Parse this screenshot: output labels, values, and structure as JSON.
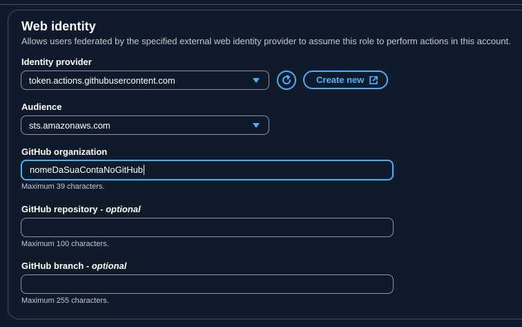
{
  "section": {
    "title": "Web identity",
    "description": "Allows users federated by the specified external web identity provider to assume this role to perform actions in this account."
  },
  "identity_provider": {
    "label": "Identity provider",
    "value": "token.actions.githubusercontent.com",
    "create_new_label": "Create new",
    "refresh_icon": "refresh-icon",
    "external_icon": "external-link-icon"
  },
  "audience": {
    "label": "Audience",
    "value": "sts.amazonaws.com"
  },
  "github_organization": {
    "label": "GitHub organization",
    "value": "nomeDaSuaContaNoGitHub",
    "hint": "Maximum 39 characters."
  },
  "github_repository": {
    "label": "GitHub repository",
    "label_suffix": "- optional",
    "value": "",
    "hint": "Maximum 100 characters."
  },
  "github_branch": {
    "label": "GitHub branch",
    "label_suffix": "- optional",
    "value": "",
    "hint": "Maximum 255 characters."
  },
  "colors": {
    "background": "#0f1b2a",
    "accent": "#42b4ff",
    "border": "#8d99a8"
  }
}
